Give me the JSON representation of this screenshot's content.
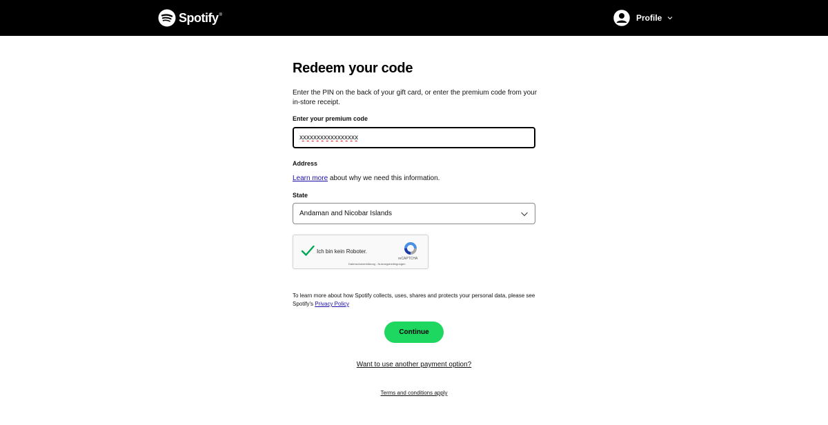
{
  "header": {
    "brand": "Spotify",
    "brand_tm": "®",
    "profile_label": "Profile",
    "logo_icon": "spotify-logo-icon",
    "avatar_icon": "user-avatar-icon"
  },
  "form": {
    "title": "Redeem your code",
    "description": "Enter the PIN on the back of your gift card, or enter the premium code from your in-store receipt.",
    "code_label": "Enter your premium code",
    "code_value": "xxxxxxxxxxxxxxxxx",
    "address_label": "Address",
    "learn_more_link": "Learn more",
    "learn_more_rest": " about why we need this information.",
    "state_label": "State",
    "state_value": "Andaman and Nicobar Islands"
  },
  "recaptcha": {
    "label": "Ich bin kein Roboter.",
    "brand": "reCAPTCHA",
    "links": "Datenschutzerklärung - Nutzungsbedingungen",
    "checked": true
  },
  "footer": {
    "privacy_text": "To learn more about how Spotify collects, uses, shares and protects your personal data, please see Spotify's ",
    "privacy_link": "Privacy Policy",
    "continue_label": "Continue",
    "another_payment": "Want to use another payment option?",
    "terms": "Terms and conditions apply"
  },
  "colors": {
    "topbar": "#000000",
    "accent_green": "#1ed760",
    "link_blue": "#1a0dab"
  }
}
